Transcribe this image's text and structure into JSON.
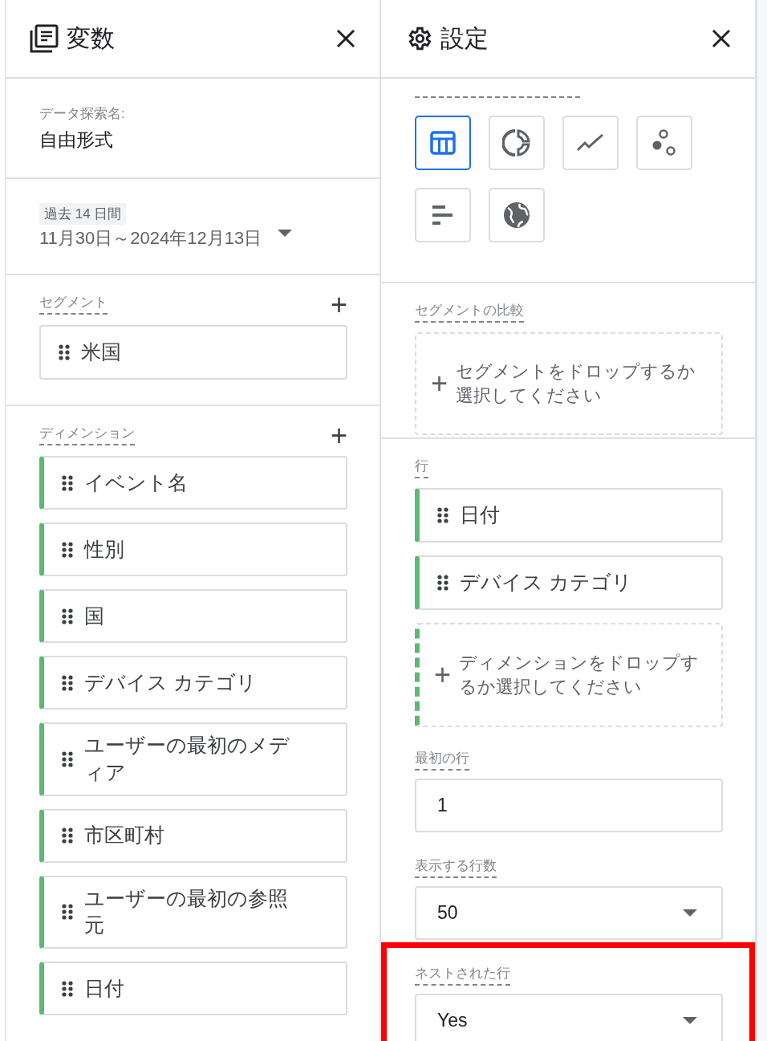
{
  "variables_panel": {
    "title": "変数",
    "exploration": {
      "label": "データ探索名:",
      "value": "自由形式"
    },
    "date_range": {
      "preset": "過去 14 日間",
      "range": "11月30日～2024年12月13日"
    },
    "segments": {
      "label": "セグメント",
      "add": "+",
      "items": [
        {
          "name": "米国"
        }
      ]
    },
    "dimensions": {
      "label": "ディメンション",
      "add": "+",
      "items": [
        {
          "name": "イベント名"
        },
        {
          "name": "性別"
        },
        {
          "name": "国"
        },
        {
          "name": "デバイス カテゴリ"
        },
        {
          "name": "ユーザーの最初のメディア"
        },
        {
          "name": "市区町村"
        },
        {
          "name": "ユーザーの最初の参照元"
        },
        {
          "name": "日付"
        }
      ]
    }
  },
  "settings_panel": {
    "title": "設定",
    "visualizations": [
      {
        "kind": "table",
        "selected": true
      },
      {
        "kind": "donut",
        "selected": false
      },
      {
        "kind": "line",
        "selected": false
      },
      {
        "kind": "scatter",
        "selected": false
      },
      {
        "kind": "bar",
        "selected": false
      },
      {
        "kind": "geo",
        "selected": false
      }
    ],
    "segment_comparison": {
      "label": "セグメントの比較",
      "add": "+",
      "drop_hint": "セグメントをドロップするか選択してください"
    },
    "rows": {
      "label": "行",
      "items": [
        {
          "name": "日付"
        },
        {
          "name": "デバイス カテゴリ"
        }
      ],
      "add": "+",
      "drop_hint": "ディメンションをドロップするか選択してください"
    },
    "fields": [
      {
        "kind": "input",
        "label": "最初の行",
        "value": "1",
        "highlighted": false
      },
      {
        "kind": "select",
        "label": "表示する行数",
        "value": "50",
        "highlighted": false
      },
      {
        "kind": "select",
        "label": "ネストされた行",
        "value": "Yes",
        "highlighted": true
      }
    ]
  }
}
